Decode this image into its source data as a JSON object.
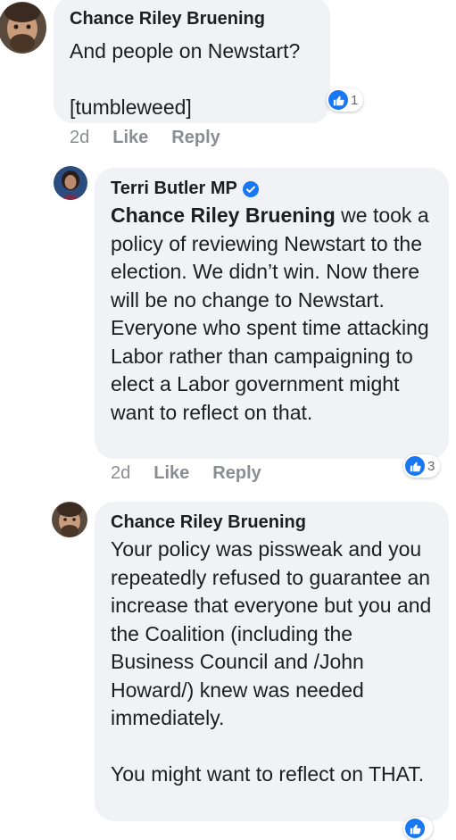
{
  "comments": [
    {
      "author": "Chance Riley Bruening",
      "text": "And people on Newstart?\n\n[tumbleweed]",
      "age": "2d",
      "like_label": "Like",
      "reply_label": "Reply",
      "reaction_count": "1",
      "reaction_icon": "like-icon"
    },
    {
      "author": "Terri Butler MP",
      "verified": true,
      "mention": "Chance Riley Bruening",
      "text": " we took a policy of reviewing Newstart to the election. We didn’t win. Now there will be no change to Newstart. Everyone who spent time attacking Labor rather than campaigning to elect a Labor government might want to reflect on that.",
      "age": "2d",
      "like_label": "Like",
      "reply_label": "Reply",
      "reaction_count": "3",
      "reaction_icon": "like-icon"
    },
    {
      "author": "Chance Riley Bruening",
      "text": "Your policy was pissweak and you repeatedly refused to guarantee an increase that everyone but you and the Coalition (including the Business Council and /John Howard/) knew was needed immediately.\n\nYou might want to reflect on THAT.",
      "reaction_icon": "like-icon"
    }
  ],
  "colors": {
    "bubble": "#f0f2f5",
    "like_blue": "#1877f2",
    "meta_gray": "#8a8d91"
  }
}
